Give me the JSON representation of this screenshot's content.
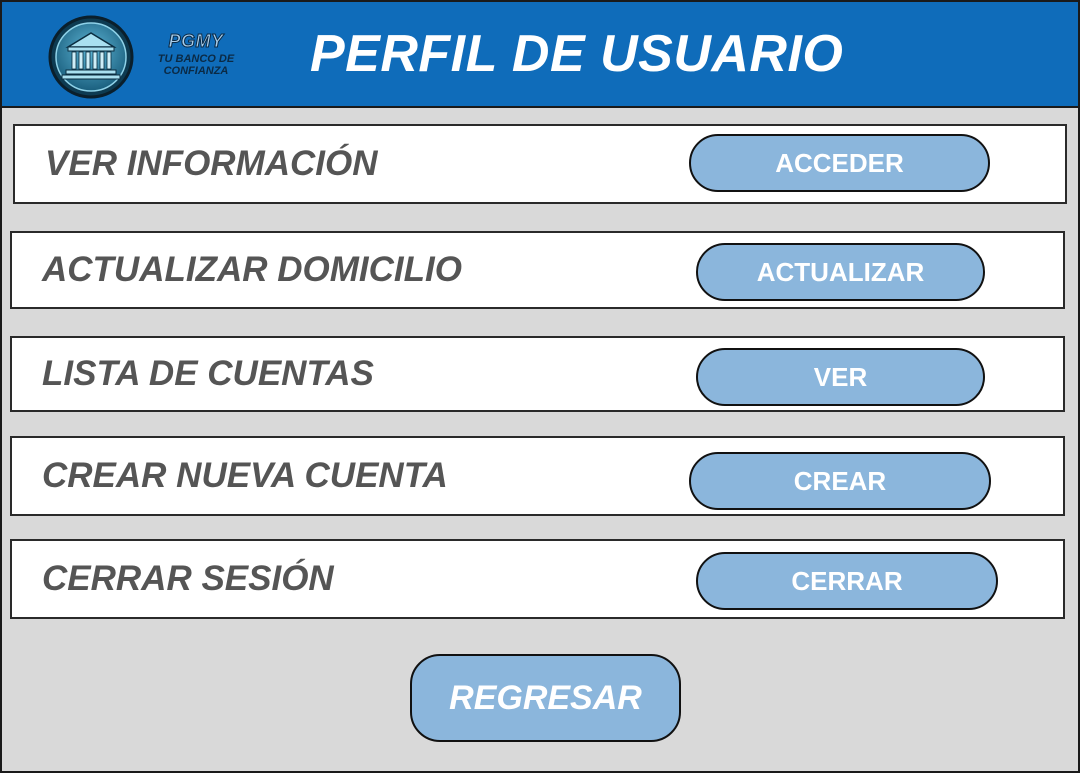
{
  "header": {
    "logo_brand": "PGMY",
    "logo_tagline": "TU BANCO DE CONFIANZA",
    "title": "PERFIL DE USUARIO",
    "background_color": "#0f6cba"
  },
  "options": [
    {
      "label": "VER INFORMACIÓN",
      "button": "ACCEDER"
    },
    {
      "label": "ACTUALIZAR DOMICILIO",
      "button": "ACTUALIZAR"
    },
    {
      "label": "LISTA DE CUENTAS",
      "button": "VER"
    },
    {
      "label": "CREAR NUEVA CUENTA",
      "button": "CREAR"
    },
    {
      "label": "CERRAR SESIÓN",
      "button": "CERRAR"
    }
  ],
  "footer": {
    "back_label": "REGRESAR"
  },
  "colors": {
    "button_fill": "#8bb6dc",
    "label_text": "#555555",
    "panel_background": "#d9d9d9"
  },
  "icons": {
    "logo": "bank-building-icon"
  }
}
